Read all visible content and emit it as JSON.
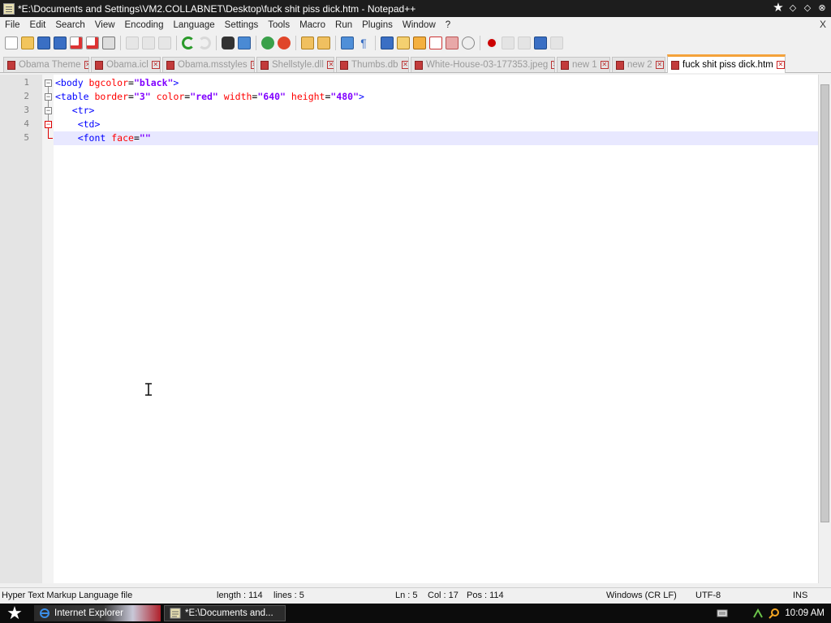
{
  "window": {
    "title": "*E:\\Documents and Settings\\VM2.COLLABNET\\Desktop\\fuck shit piss dick.htm - Notepad++"
  },
  "menu": [
    "File",
    "Edit",
    "Search",
    "View",
    "Encoding",
    "Language",
    "Settings",
    "Tools",
    "Macro",
    "Run",
    "Plugins",
    "Window",
    "?"
  ],
  "menu_close": "X",
  "tabs": [
    {
      "label": "Obama Theme"
    },
    {
      "label": "Obama.icl"
    },
    {
      "label": "Obama.msstyles"
    },
    {
      "label": "Shellstyle.dll"
    },
    {
      "label": "Thumbs.db"
    },
    {
      "label": "White-House-03-177353.jpeg"
    },
    {
      "label": "new 1"
    },
    {
      "label": "new 2"
    },
    {
      "label": "fuck shit piss dick.htm",
      "active": true
    }
  ],
  "editor": {
    "line_numbers": [
      "1",
      "2",
      "3",
      "4",
      "5"
    ],
    "current_line": 5,
    "lines": [
      [
        {
          "t": "<body ",
          "c": "tag"
        },
        {
          "t": "bgcolor",
          "c": "attr"
        },
        {
          "t": "=",
          "c": "txt"
        },
        {
          "t": "\"black\"",
          "c": "val"
        },
        {
          "t": ">",
          "c": "tag"
        }
      ],
      [
        {
          "t": "<table ",
          "c": "tag"
        },
        {
          "t": "border",
          "c": "attr"
        },
        {
          "t": "=",
          "c": "txt"
        },
        {
          "t": "\"3\"",
          "c": "val"
        },
        {
          "t": " ",
          "c": "txt"
        },
        {
          "t": "color",
          "c": "attr"
        },
        {
          "t": "=",
          "c": "txt"
        },
        {
          "t": "\"red\"",
          "c": "val"
        },
        {
          "t": " ",
          "c": "txt"
        },
        {
          "t": "width",
          "c": "attr"
        },
        {
          "t": "=",
          "c": "txt"
        },
        {
          "t": "\"640\"",
          "c": "val"
        },
        {
          "t": " ",
          "c": "txt"
        },
        {
          "t": "height",
          "c": "attr"
        },
        {
          "t": "=",
          "c": "txt"
        },
        {
          "t": "\"480\"",
          "c": "val"
        },
        {
          "t": ">",
          "c": "tag"
        }
      ],
      [
        {
          "t": "   <tr>",
          "c": "tag"
        }
      ],
      [
        {
          "t": "    <td>",
          "c": "tag"
        }
      ],
      [
        {
          "t": "    <font ",
          "c": "tag"
        },
        {
          "t": "face",
          "c": "attr"
        },
        {
          "t": "=",
          "c": "txt"
        },
        {
          "t": "\"\"",
          "c": "val"
        }
      ]
    ]
  },
  "status": {
    "file_type": "Hyper Text Markup Language file",
    "length": "length : 114",
    "lines": "lines : 5",
    "ln": "Ln : 5",
    "col": "Col : 17",
    "pos": "Pos : 114",
    "eol": "Windows (CR LF)",
    "encoding": "UTF-8",
    "mode": "INS"
  },
  "taskbar": {
    "start_icon": "star-icon",
    "items": [
      {
        "label": "Internet Explorer",
        "icon": "ie-icon"
      },
      {
        "label": "*E:\\Documents and...",
        "icon": "notepad-icon"
      }
    ],
    "clock": "10:09 AM"
  },
  "colors": {
    "tag": "#0000ff",
    "attr": "#ff0000",
    "value": "#8000ff",
    "active_tab_accent": "#f4a23a",
    "current_line_bg": "#e8e8ff"
  }
}
